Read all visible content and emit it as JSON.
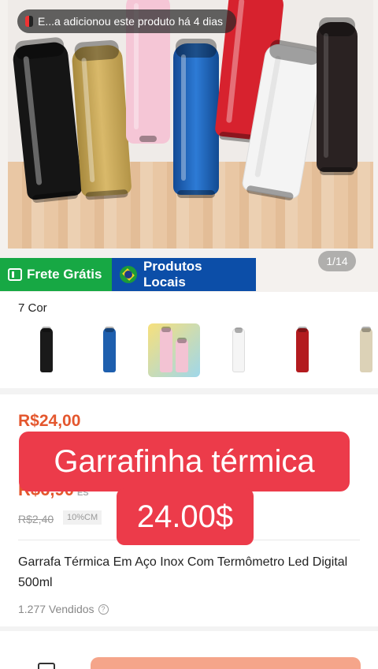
{
  "hero": {
    "toast_text": "E...a adicionou este produto há 4 dias",
    "pager": "1/14",
    "tags": {
      "free_shipping": "Frete Grátis",
      "local_products": "Produtos Locais"
    },
    "bottle_colors": [
      "#151515",
      "#c9a557",
      "#f5c6d6",
      "#1d5fb5",
      "#d7222e",
      "#f4f4f4",
      "#2a2222"
    ]
  },
  "colors": {
    "label": "7 Cor",
    "swatches": [
      {
        "name": "black",
        "color": "#1a1a1a"
      },
      {
        "name": "blue",
        "color": "#1e5fae"
      },
      {
        "name": "pink",
        "color": "#f3c3d3"
      },
      {
        "name": "white",
        "color": "#f5f5f5"
      },
      {
        "name": "red",
        "color": "#b31b1f"
      },
      {
        "name": "gold",
        "color": "#dcd2b7"
      }
    ],
    "selected_index": 2
  },
  "product": {
    "price": "R$24,00",
    "price_secondary": "R$6,90",
    "price_secondary_suffix": "ES",
    "old_price": "R$2,40",
    "discount": "10%CM",
    "title": "Garrafa Térmica Em Aço Inox Com Termômetro Led Digital 500ml",
    "sold": "1.277 Vendidos",
    "sold_help_icon": "?"
  },
  "overlay": {
    "line1": "Garrafinha térmica",
    "line2": "24.00$"
  },
  "theme": {
    "accent": "#e4572e",
    "overlay_red": "#ec3b4a",
    "free_shipping_green": "#17a844",
    "local_blue": "#0c4ea8"
  }
}
